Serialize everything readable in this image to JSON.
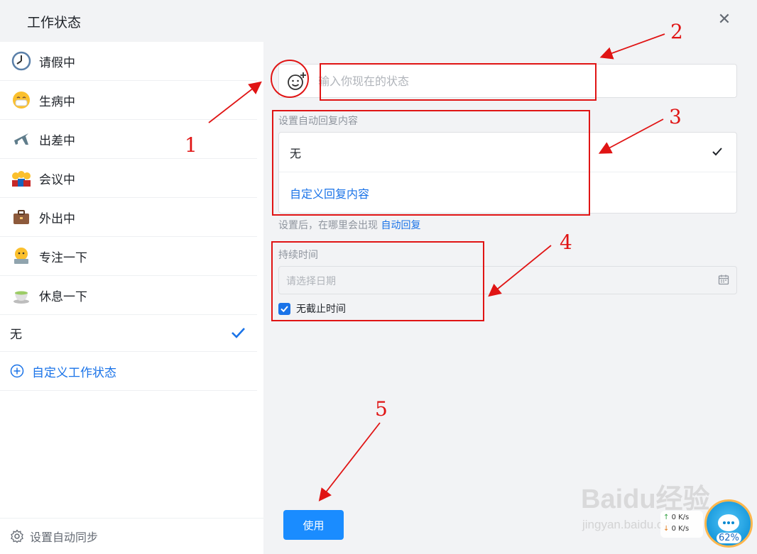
{
  "dialog": {
    "title": "工作状态",
    "close_icon": "close-icon"
  },
  "left": {
    "items": [
      {
        "label": "请假中",
        "icon": "clock-icon"
      },
      {
        "label": "生病中",
        "icon": "mask-face-icon"
      },
      {
        "label": "出差中",
        "icon": "airplane-icon"
      },
      {
        "label": "会议中",
        "icon": "meeting-icon"
      },
      {
        "label": "外出中",
        "icon": "briefcase-icon"
      },
      {
        "label": "专注一下",
        "icon": "focus-laptop-icon"
      },
      {
        "label": "休息一下",
        "icon": "tea-cup-icon"
      }
    ],
    "none_label": "无",
    "custom_label": "自定义工作状态",
    "sync_label": "设置自动同步"
  },
  "right": {
    "status_placeholder": "输入你现在的状态",
    "reply_section_label": "设置自动回复内容",
    "reply_options": [
      "无",
      "自定义回复内容"
    ],
    "hint_text": "设置后，在哪里会出现",
    "hint_link": "自动回复",
    "duration_label": "持续时间",
    "date_placeholder": "请选择日期",
    "no_end_label": "无截止时间",
    "no_end_checked": true,
    "use_button": "使用"
  },
  "annotations": {
    "labels": [
      "1",
      "2",
      "3",
      "4",
      "5"
    ],
    "color": "#e01414"
  },
  "overlay": {
    "watermark": "Baidu经验",
    "watermark_sub": "jingyan.baidu.com",
    "speed_up": "0 K/s",
    "speed_down": "0 K/s",
    "ball_percent": "62%"
  },
  "colors": {
    "accent": "#1a73e8",
    "button": "#1a8cff",
    "annotation": "#e01414"
  }
}
